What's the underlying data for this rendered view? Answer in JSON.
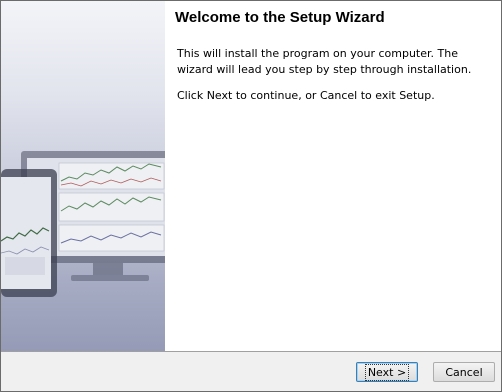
{
  "wizard": {
    "title": "Welcome to the Setup Wizard",
    "paragraphs": [
      "This will install the program on your computer. The wizard will lead you step by step through installation.",
      "Click Next to continue, or Cancel to exit Setup."
    ]
  },
  "buttons": {
    "next_label": "Next >",
    "cancel_label": "Cancel"
  },
  "colors": {
    "banner_top": "#f3f4f8",
    "banner_bottom": "#959bb6",
    "footer_bg": "#f0f0f0",
    "default_button_border": "#3c7fb1"
  },
  "banner_image": "laptop-and-tablet-showing-stock-charts"
}
